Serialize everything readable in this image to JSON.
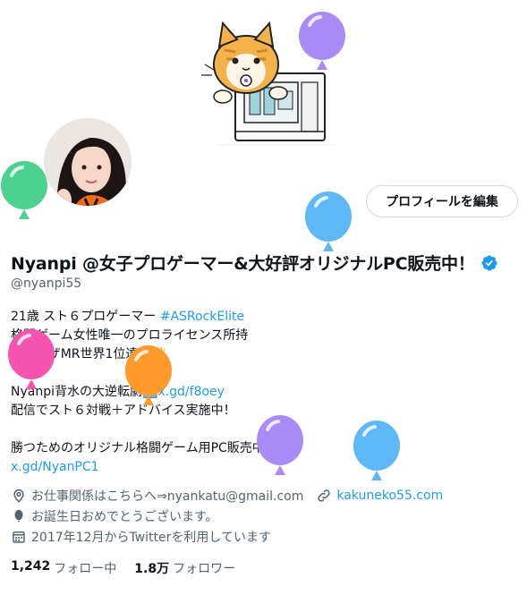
{
  "profile": {
    "edit_button": "プロフィールを編集",
    "display_name": "Nyanpi @女子プロゲーマー&大好評オリジナルPC販売中！",
    "handle": "@nyanpi55"
  },
  "bio": {
    "line1_text": "21歳 スト６プロゲーマー ",
    "line1_hashtag": "#ASRockElite",
    "line2": "格闘ゲーム女性唯一のプロライセンス所持",
    "line3": "マリーザMR世界1位達成👑",
    "line5_text": "Nyanpi背水の大逆転劇➡️",
    "line5_link": "x.gd/f8oey",
    "line6": "配信でスト６対戦＋アドバイス実施中！",
    "line8": "勝つためのオリジナル格闘ゲーム用PC販売中❗",
    "line9_link": "x.gd/NyanPC1"
  },
  "meta": {
    "location": "お仕事関係はこちらへ⇒nyankatu@gmail.com",
    "website": "kakuneko55.com",
    "birthday": "お誕生日おめでとうございます。",
    "joined": "2017年12月からTwitterを利用しています"
  },
  "stats": {
    "following_count": "1,242",
    "following_label": "フォロー中",
    "followers_count": "1.8万",
    "followers_label": "フォロワー"
  },
  "colors": {
    "accent": "#1d9bf0",
    "balloon_green": "#4cd18f",
    "balloon_purple": "#a98bf6",
    "balloon_blue": "#5db8f5",
    "balloon_pink": "#f553b0",
    "balloon_orange": "#ff9a2b"
  }
}
